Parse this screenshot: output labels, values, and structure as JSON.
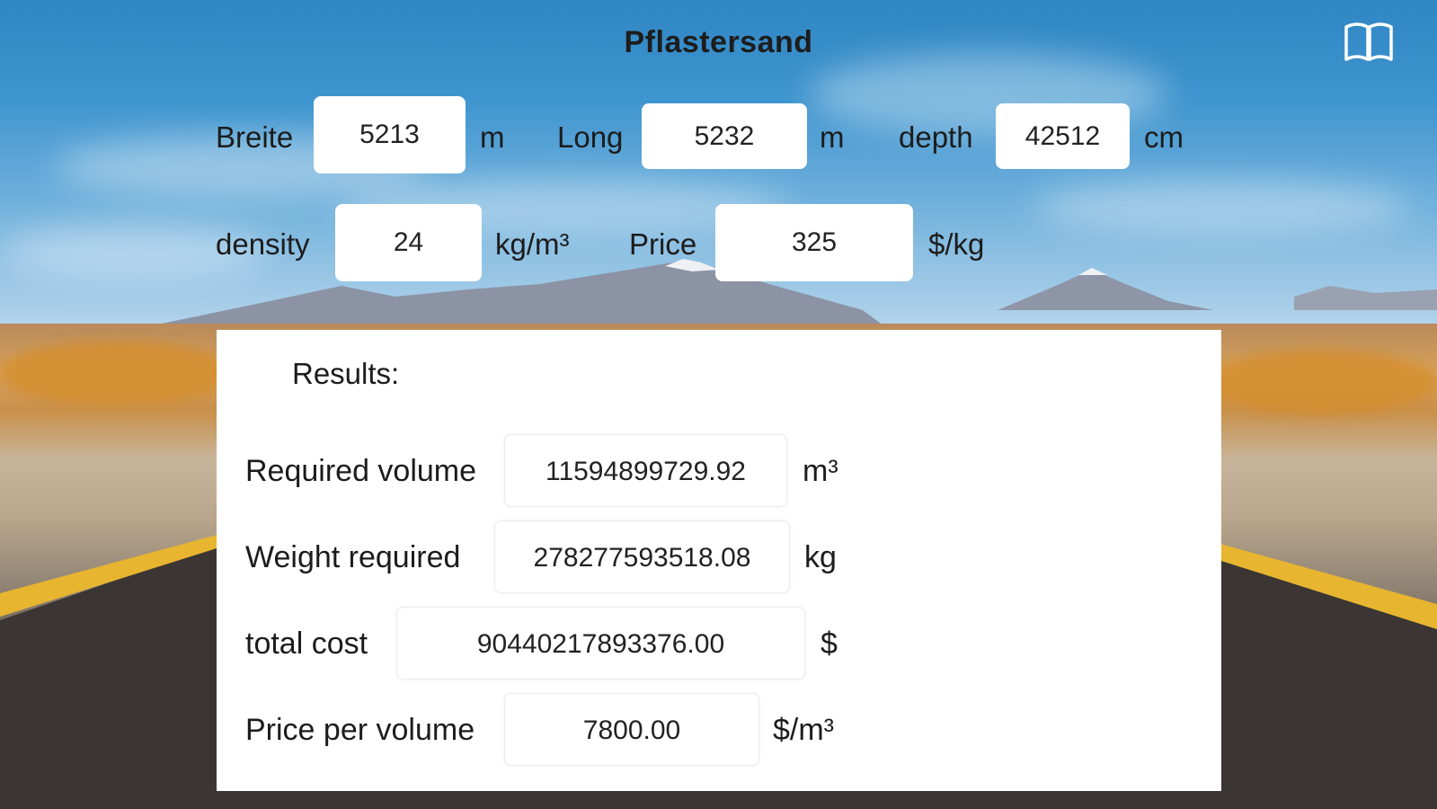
{
  "title": "Pflastersand",
  "icons": {
    "book": "book-icon"
  },
  "inputs": {
    "width": {
      "label": "Breite",
      "value": "5213",
      "unit": "m"
    },
    "length": {
      "label": "Long",
      "value": "5232",
      "unit": "m"
    },
    "depth": {
      "label": "depth",
      "value": "42512",
      "unit": "cm"
    },
    "density": {
      "label": "density",
      "value": "24",
      "unit": "kg/m³"
    },
    "price": {
      "label": "Price",
      "value": "325",
      "unit": "$/kg"
    }
  },
  "results": {
    "heading": "Results:",
    "volume": {
      "label": "Required volume",
      "value": "11594899729.92",
      "unit": "m³"
    },
    "weight": {
      "label": "Weight required",
      "value": "278277593518.08",
      "unit": "kg"
    },
    "cost": {
      "label": "total cost",
      "value": "90440217893376.00",
      "unit": "$"
    },
    "price_per_volume": {
      "label": "Price per volume",
      "value": "7800.00",
      "unit": "$/m³"
    }
  }
}
